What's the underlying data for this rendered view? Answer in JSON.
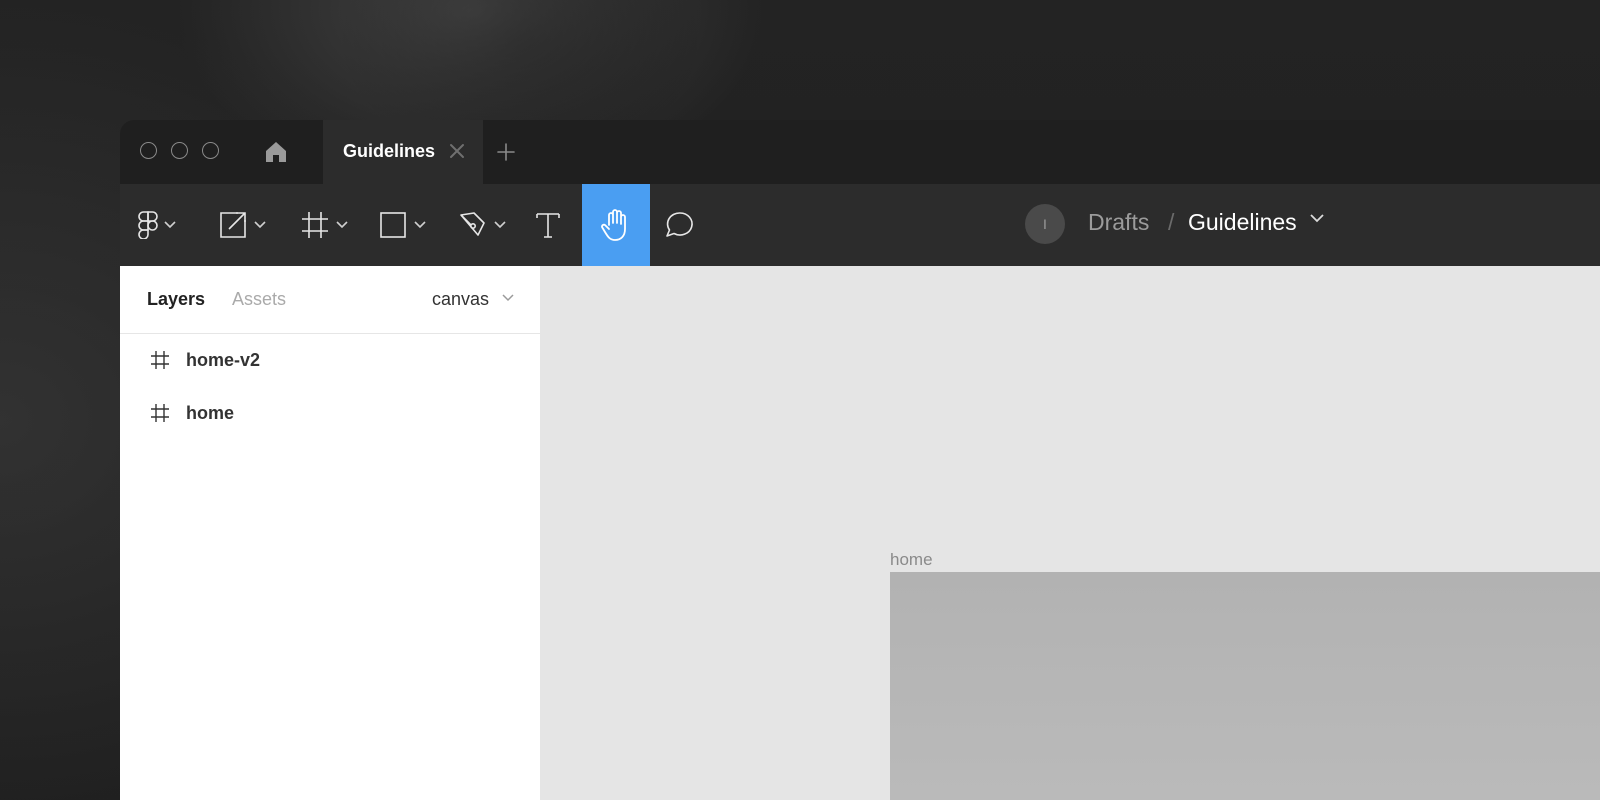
{
  "titlebar": {
    "home_icon": "home-icon",
    "active_tab": {
      "title": "Guidelines",
      "close_icon": "close-icon"
    },
    "new_tab_icon": "plus-icon"
  },
  "toolbar": {
    "tools": [
      {
        "name": "main-menu",
        "icon": "figma-logo-icon",
        "has_dropdown": true
      },
      {
        "name": "move",
        "icon": "move-scale-icon",
        "has_dropdown": true
      },
      {
        "name": "frame",
        "icon": "frame-hash-icon",
        "has_dropdown": true
      },
      {
        "name": "shape",
        "icon": "rectangle-icon",
        "has_dropdown": true
      },
      {
        "name": "pen",
        "icon": "pen-icon",
        "has_dropdown": true
      },
      {
        "name": "text",
        "icon": "text-icon",
        "has_dropdown": false
      },
      {
        "name": "hand",
        "icon": "hand-icon",
        "active": true
      },
      {
        "name": "comment",
        "icon": "comment-icon",
        "has_dropdown": false
      }
    ],
    "accent_color": "#4a9ef2"
  },
  "breadcrumb": {
    "avatar_initial": "I",
    "project": "Drafts",
    "separator": "/",
    "file": "Guidelines"
  },
  "sidebar": {
    "tabs": {
      "layers": "Layers",
      "assets": "Assets"
    },
    "page_selector": "canvas",
    "layers": [
      {
        "label": "home-v2",
        "icon": "frame-hash-icon"
      },
      {
        "label": "home",
        "icon": "frame-hash-icon"
      }
    ]
  },
  "canvas": {
    "frame_label": "home"
  }
}
